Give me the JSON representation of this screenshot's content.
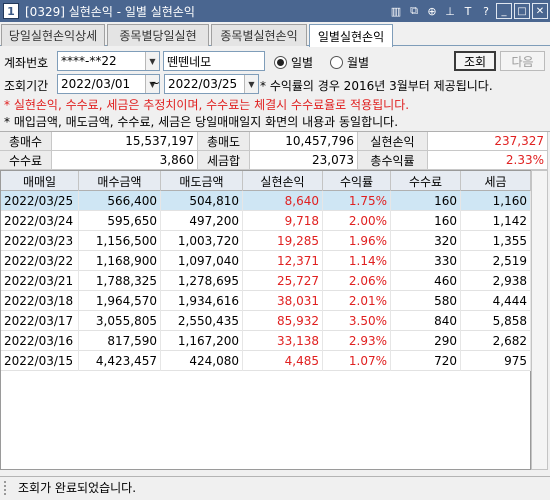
{
  "window": {
    "number": "1",
    "title": "[0329] 실현손익 - 일별 실현손익",
    "icons": [
      "window-list-icon",
      "new-window-icon",
      "link-icon",
      "pin-icon",
      "font-icon",
      "help-icon",
      "minimize-icon",
      "maximize-icon",
      "close-icon"
    ],
    "icon_glyphs": [
      "▥",
      "⧉",
      "⊕",
      "⊥",
      "T",
      "?",
      "_",
      "□",
      "✕"
    ]
  },
  "tabs": [
    "당일실현손익상세",
    "종목별당일실현",
    "종목별실현손익",
    "일별실현손익"
  ],
  "active_tab": 3,
  "filters": {
    "account_label": "계좌번호",
    "account_value": "****-**22",
    "account_name": "뗀뗀네모",
    "radio_daily": "일별",
    "radio_monthly": "월별",
    "radio_selected": "daily",
    "period_label": "조회기간",
    "date_from": "2022/03/01",
    "date_sep": "~",
    "date_to": "2022/03/25",
    "period_note": "* 수익률의 경우 2016년 3월부터 제공됩니다.",
    "query_button": "조회",
    "next_button": "다음"
  },
  "notes": {
    "red": "* 실현손익, 수수료, 세금은 추정치이며, 수수료는 체결시 수수료율로 적용됩니다.",
    "black": "* 매입금액, 매도금액, 수수료, 세금은 당일매매일지 화면의 내용과 동일합니다."
  },
  "summary": {
    "total_buy_label": "총매수",
    "total_buy": "15,537,197",
    "total_sell_label": "총매도",
    "total_sell": "10,457,796",
    "realized_label": "실현손익",
    "realized": "237,327",
    "fee_label": "수수료",
    "fee": "3,860",
    "tax_sum_label": "세금합",
    "tax_sum": "23,073",
    "total_return_label": "총수익률",
    "total_return": "2.33%"
  },
  "table": {
    "columns": [
      "매매일",
      "매수금액",
      "매도금액",
      "실현손익",
      "수익률",
      "수수료",
      "세금"
    ],
    "rows": [
      [
        "2022/03/25",
        "566,400",
        "504,810",
        "8,640",
        "1.75%",
        "160",
        "1,160"
      ],
      [
        "2022/03/24",
        "595,650",
        "497,200",
        "9,718",
        "2.00%",
        "160",
        "1,142"
      ],
      [
        "2022/03/23",
        "1,156,500",
        "1,003,720",
        "19,285",
        "1.96%",
        "320",
        "1,355"
      ],
      [
        "2022/03/22",
        "1,168,900",
        "1,097,040",
        "12,371",
        "1.14%",
        "330",
        "2,519"
      ],
      [
        "2022/03/21",
        "1,788,325",
        "1,278,695",
        "25,727",
        "2.06%",
        "460",
        "2,938"
      ],
      [
        "2022/03/18",
        "1,964,570",
        "1,934,616",
        "38,031",
        "2.01%",
        "580",
        "4,444"
      ],
      [
        "2022/03/17",
        "3,055,805",
        "2,550,435",
        "85,932",
        "3.50%",
        "840",
        "5,858"
      ],
      [
        "2022/03/16",
        "817,590",
        "1,167,200",
        "33,138",
        "2.93%",
        "290",
        "2,682"
      ],
      [
        "2022/03/15",
        "4,423,457",
        "424,080",
        "4,485",
        "1.07%",
        "720",
        "975"
      ]
    ],
    "selected_row": 0
  },
  "status": "조회가 완료되었습니다.",
  "colors": {
    "title_bg": "#4a6690",
    "profit": "#e02020",
    "selected_row": "#cfe6f4",
    "header_bg": "#e6ebf2"
  }
}
